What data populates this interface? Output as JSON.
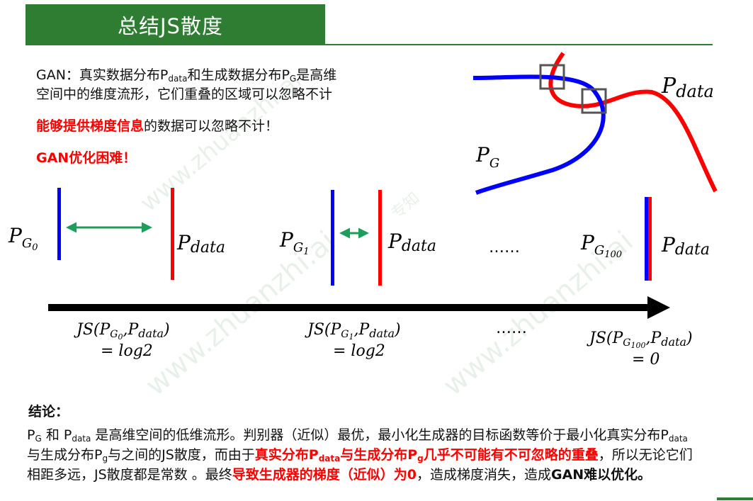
{
  "title": "总结JS散度",
  "intro": {
    "line1_a": "GAN：真实数据分布P",
    "line1_sub1": "data",
    "line1_b": "和生成数据分布P",
    "line1_sub2": "G",
    "line1_c": "是高维",
    "line2": "空间中的维度流形，它们重叠的区域可以忽略不计",
    "line3_red": "能够提供梯度信息",
    "line3_rest": "的数据可以忽略不计！",
    "line4_red": "GAN优化困难！"
  },
  "diagram": {
    "pdata_label": "P",
    "pdata_sub": "data",
    "pg_label": "P",
    "pg_sub": "G",
    "g0_sub": "G",
    "g0_subsub": "0",
    "g1_sub": "G",
    "g1_subsub": "1",
    "g100_sub": "G",
    "g100_subsub": "100",
    "ellipsis": "……",
    "js_prefix": "JS(",
    "js_sep": ",",
    "js_suffix": ")",
    "js_value_1": "= log2",
    "js_value_2": "= log2",
    "js_value_3": "= 0",
    "ellipsis_bottom": "……"
  },
  "watermark": {
    "text1": "www.zhuanzhi.ai",
    "text2": "专知"
  },
  "conclusion": {
    "heading": "结论：",
    "p1_a": "P",
    "p1_sub_g": "G",
    "p1_b": " 和 P",
    "p1_sub_data": "data",
    "p1_c": " 是高维空间的低维流形。判别器（近似）最优，最小化生成器的目标函数等价于最小化真实分布P",
    "p1_sub_data2": "data",
    "p1_d": "与生成分布P",
    "p1_sub_g2": "g",
    "p1_e": "与之间的JS散度，而由于",
    "p1_red1_a": "真实分布P",
    "p1_red1_sub": "data",
    "p1_red1_b": "与生成分布P",
    "p1_red1_sub2": "g",
    "p1_red1_c": "几乎不可能有不可忽略的重叠",
    "p1_f": "，所以无论它们相距多远，JS散度都是常数 。最终",
    "p1_red2": "导致生成器的梯度（近似）为0",
    "p1_g": "，造成梯度消失，造成",
    "p1_bold": "GAN难以优化。"
  },
  "colors": {
    "brand_green": "#2e7d32",
    "pdata_red": "#ff0000",
    "pg_blue": "#0000ff",
    "arrow_green": "#1e9e5a",
    "axis_black": "#000000"
  }
}
